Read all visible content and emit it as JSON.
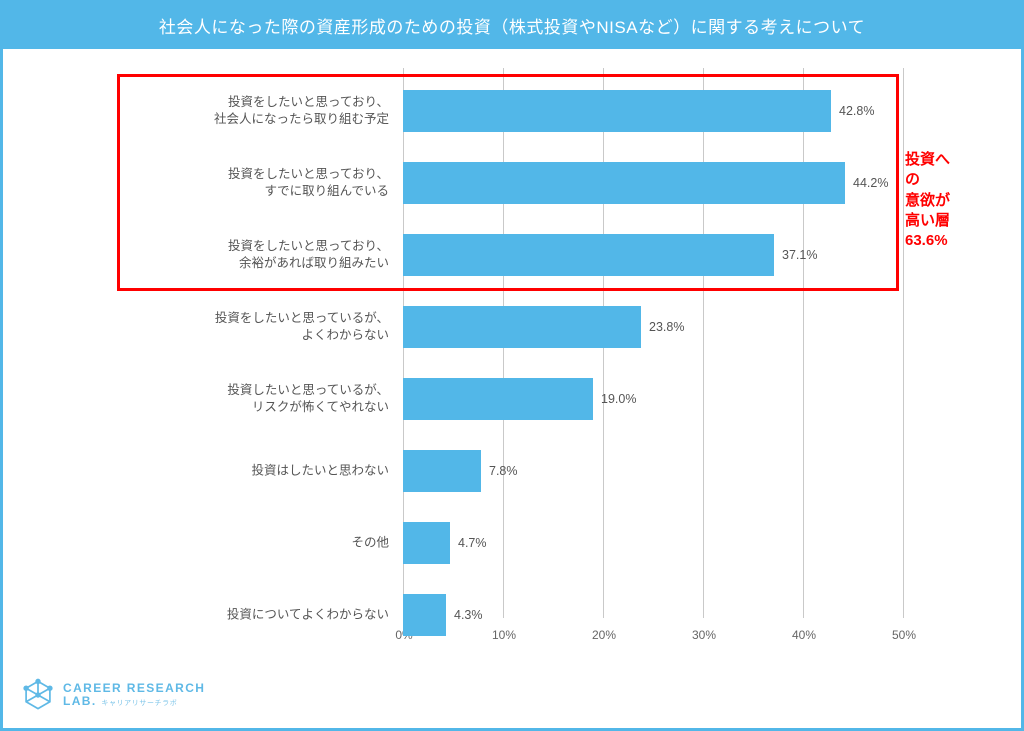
{
  "title": "社会人になった際の資産形成のための投資（株式投資やNISAなど）に関する考えについて",
  "chart_data": {
    "type": "bar",
    "orientation": "horizontal",
    "categories": [
      "投資をしたいと思っており、\n社会人になったら取り組む予定",
      "投資をしたいと思っており、\nすでに取り組んでいる",
      "投資をしたいと思っており、\n余裕があれば取り組みたい",
      "投資をしたいと思っているが、\nよくわからない",
      "投資したいと思っているが、\nリスクが怖くてやれない",
      "投資はしたいと思わない",
      "その他",
      "投資についてよくわからない"
    ],
    "values": [
      42.8,
      44.2,
      37.1,
      23.8,
      19.0,
      7.8,
      4.7,
      4.3
    ],
    "xlabel": "",
    "ylabel": "",
    "xlim": [
      0,
      50
    ],
    "ticks": [
      0,
      10,
      20,
      30,
      40,
      50
    ],
    "unit": "%"
  },
  "annotation": {
    "line1": "投資への",
    "line2": "意欲が高い層",
    "line3": "63.6%"
  },
  "tick_labels": [
    "0%",
    "10%",
    "20%",
    "30%",
    "40%",
    "50%"
  ],
  "value_labels": [
    "42.8%",
    "44.2%",
    "37.1%",
    "23.8%",
    "19.0%",
    "7.8%",
    "4.7%",
    "4.3%"
  ],
  "logo": {
    "top": "CAREER RESEARCH",
    "bottom": "LAB.",
    "sub": "キャリアリサーチラボ"
  }
}
